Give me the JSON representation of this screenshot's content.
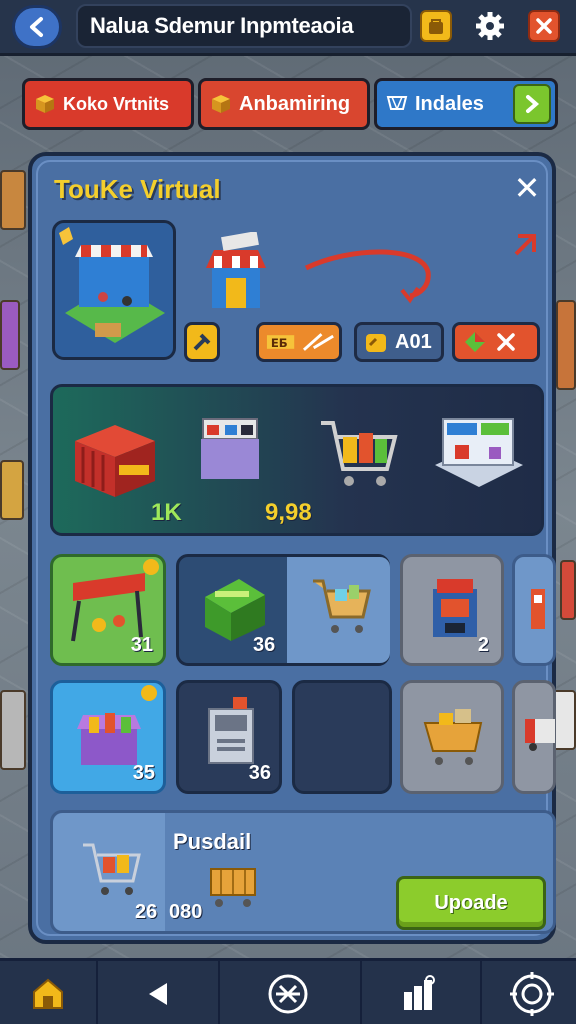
{
  "header": {
    "title": "Nalua Sdemur Inpmteaoia",
    "back_icon": "back-arrow-icon",
    "store_icon": "shop-bag-icon",
    "settings_icon": "gear-icon",
    "close_icon": "close-icon"
  },
  "tabs": [
    {
      "label": "Koko Vrtnits",
      "icon": "crate-icon",
      "color": "#d93a2b"
    },
    {
      "label": "Anbamiring",
      "icon": "crate-icon",
      "color": "#d9462f"
    },
    {
      "label": "Indales",
      "icon": "cart-icon",
      "color": "#2f78c8"
    }
  ],
  "tab_next_icon": "chevron-right-icon",
  "panel": {
    "title": "TouKe Virtual",
    "close_label": "✕",
    "pills": [
      {
        "label": "",
        "icon": "hammer-icon"
      },
      {
        "label": "",
        "icon": "tools-icon"
      },
      {
        "label": "A01",
        "icon": "coin-bag-icon"
      },
      {
        "label": "",
        "icon": "gem-icon"
      }
    ],
    "showcase": {
      "value_left": "1K",
      "value_right": "9,98"
    },
    "grid": [
      {
        "count": "31",
        "icon": "market-stall-icon",
        "badge": true
      },
      {
        "count": "36",
        "icon": "produce-crate-icon",
        "badge": false
      },
      {
        "count": "",
        "icon": "shopping-cart-icon",
        "badge": false
      },
      {
        "count": "2",
        "icon": "arcade-kiosk-icon",
        "badge": false
      },
      {
        "count": "",
        "icon": "vending-icon",
        "badge": false
      },
      {
        "count": "35",
        "icon": "candy-stall-icon",
        "badge": true
      },
      {
        "count": "36",
        "icon": "atm-kiosk-icon",
        "badge": false
      },
      {
        "count": "",
        "icon": "",
        "badge": false
      },
      {
        "count": "",
        "icon": "basket-cart-icon",
        "badge": false
      },
      {
        "count": "",
        "icon": "truck-icon",
        "badge": false
      }
    ],
    "footer": {
      "label": "Pusdail",
      "count_left": "26",
      "count_right": "080",
      "upgrade_label": "Upoade"
    }
  },
  "bottom_nav": [
    {
      "icon": "home-lock-icon"
    },
    {
      "icon": "play-back-icon"
    },
    {
      "icon": "compass-crossed-icon"
    },
    {
      "icon": "stats-bars-icon"
    },
    {
      "icon": "target-gear-icon"
    }
  ]
}
